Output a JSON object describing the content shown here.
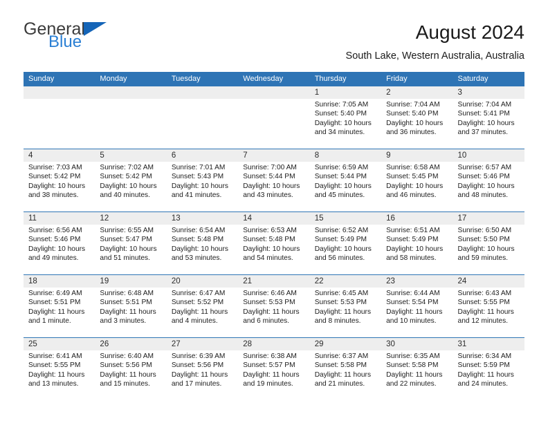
{
  "brand": {
    "name_part1": "General",
    "name_part2": "Blue",
    "triangle_color": "#1565b8",
    "blue_color": "#2a7fd4"
  },
  "header": {
    "title": "August 2024",
    "location": "South Lake, Western Australia, Australia"
  },
  "theme": {
    "header_blue": "#2e74b5",
    "daynum_band": "#eeeeee",
    "text": "#1c1c1c"
  },
  "weekdays": [
    "Sunday",
    "Monday",
    "Tuesday",
    "Wednesday",
    "Thursday",
    "Friday",
    "Saturday"
  ],
  "weeks": [
    [
      {
        "empty": true
      },
      {
        "empty": true
      },
      {
        "empty": true
      },
      {
        "empty": true
      },
      {
        "day": "1",
        "sunrise": "Sunrise: 7:05 AM",
        "sunset": "Sunset: 5:40 PM",
        "daylight1": "Daylight: 10 hours",
        "daylight2": "and 34 minutes."
      },
      {
        "day": "2",
        "sunrise": "Sunrise: 7:04 AM",
        "sunset": "Sunset: 5:40 PM",
        "daylight1": "Daylight: 10 hours",
        "daylight2": "and 36 minutes."
      },
      {
        "day": "3",
        "sunrise": "Sunrise: 7:04 AM",
        "sunset": "Sunset: 5:41 PM",
        "daylight1": "Daylight: 10 hours",
        "daylight2": "and 37 minutes."
      }
    ],
    [
      {
        "day": "4",
        "sunrise": "Sunrise: 7:03 AM",
        "sunset": "Sunset: 5:42 PM",
        "daylight1": "Daylight: 10 hours",
        "daylight2": "and 38 minutes."
      },
      {
        "day": "5",
        "sunrise": "Sunrise: 7:02 AM",
        "sunset": "Sunset: 5:42 PM",
        "daylight1": "Daylight: 10 hours",
        "daylight2": "and 40 minutes."
      },
      {
        "day": "6",
        "sunrise": "Sunrise: 7:01 AM",
        "sunset": "Sunset: 5:43 PM",
        "daylight1": "Daylight: 10 hours",
        "daylight2": "and 41 minutes."
      },
      {
        "day": "7",
        "sunrise": "Sunrise: 7:00 AM",
        "sunset": "Sunset: 5:44 PM",
        "daylight1": "Daylight: 10 hours",
        "daylight2": "and 43 minutes."
      },
      {
        "day": "8",
        "sunrise": "Sunrise: 6:59 AM",
        "sunset": "Sunset: 5:44 PM",
        "daylight1": "Daylight: 10 hours",
        "daylight2": "and 45 minutes."
      },
      {
        "day": "9",
        "sunrise": "Sunrise: 6:58 AM",
        "sunset": "Sunset: 5:45 PM",
        "daylight1": "Daylight: 10 hours",
        "daylight2": "and 46 minutes."
      },
      {
        "day": "10",
        "sunrise": "Sunrise: 6:57 AM",
        "sunset": "Sunset: 5:46 PM",
        "daylight1": "Daylight: 10 hours",
        "daylight2": "and 48 minutes."
      }
    ],
    [
      {
        "day": "11",
        "sunrise": "Sunrise: 6:56 AM",
        "sunset": "Sunset: 5:46 PM",
        "daylight1": "Daylight: 10 hours",
        "daylight2": "and 49 minutes."
      },
      {
        "day": "12",
        "sunrise": "Sunrise: 6:55 AM",
        "sunset": "Sunset: 5:47 PM",
        "daylight1": "Daylight: 10 hours",
        "daylight2": "and 51 minutes."
      },
      {
        "day": "13",
        "sunrise": "Sunrise: 6:54 AM",
        "sunset": "Sunset: 5:48 PM",
        "daylight1": "Daylight: 10 hours",
        "daylight2": "and 53 minutes."
      },
      {
        "day": "14",
        "sunrise": "Sunrise: 6:53 AM",
        "sunset": "Sunset: 5:48 PM",
        "daylight1": "Daylight: 10 hours",
        "daylight2": "and 54 minutes."
      },
      {
        "day": "15",
        "sunrise": "Sunrise: 6:52 AM",
        "sunset": "Sunset: 5:49 PM",
        "daylight1": "Daylight: 10 hours",
        "daylight2": "and 56 minutes."
      },
      {
        "day": "16",
        "sunrise": "Sunrise: 6:51 AM",
        "sunset": "Sunset: 5:49 PM",
        "daylight1": "Daylight: 10 hours",
        "daylight2": "and 58 minutes."
      },
      {
        "day": "17",
        "sunrise": "Sunrise: 6:50 AM",
        "sunset": "Sunset: 5:50 PM",
        "daylight1": "Daylight: 10 hours",
        "daylight2": "and 59 minutes."
      }
    ],
    [
      {
        "day": "18",
        "sunrise": "Sunrise: 6:49 AM",
        "sunset": "Sunset: 5:51 PM",
        "daylight1": "Daylight: 11 hours",
        "daylight2": "and 1 minute."
      },
      {
        "day": "19",
        "sunrise": "Sunrise: 6:48 AM",
        "sunset": "Sunset: 5:51 PM",
        "daylight1": "Daylight: 11 hours",
        "daylight2": "and 3 minutes."
      },
      {
        "day": "20",
        "sunrise": "Sunrise: 6:47 AM",
        "sunset": "Sunset: 5:52 PM",
        "daylight1": "Daylight: 11 hours",
        "daylight2": "and 4 minutes."
      },
      {
        "day": "21",
        "sunrise": "Sunrise: 6:46 AM",
        "sunset": "Sunset: 5:53 PM",
        "daylight1": "Daylight: 11 hours",
        "daylight2": "and 6 minutes."
      },
      {
        "day": "22",
        "sunrise": "Sunrise: 6:45 AM",
        "sunset": "Sunset: 5:53 PM",
        "daylight1": "Daylight: 11 hours",
        "daylight2": "and 8 minutes."
      },
      {
        "day": "23",
        "sunrise": "Sunrise: 6:44 AM",
        "sunset": "Sunset: 5:54 PM",
        "daylight1": "Daylight: 11 hours",
        "daylight2": "and 10 minutes."
      },
      {
        "day": "24",
        "sunrise": "Sunrise: 6:43 AM",
        "sunset": "Sunset: 5:55 PM",
        "daylight1": "Daylight: 11 hours",
        "daylight2": "and 12 minutes."
      }
    ],
    [
      {
        "day": "25",
        "sunrise": "Sunrise: 6:41 AM",
        "sunset": "Sunset: 5:55 PM",
        "daylight1": "Daylight: 11 hours",
        "daylight2": "and 13 minutes."
      },
      {
        "day": "26",
        "sunrise": "Sunrise: 6:40 AM",
        "sunset": "Sunset: 5:56 PM",
        "daylight1": "Daylight: 11 hours",
        "daylight2": "and 15 minutes."
      },
      {
        "day": "27",
        "sunrise": "Sunrise: 6:39 AM",
        "sunset": "Sunset: 5:56 PM",
        "daylight1": "Daylight: 11 hours",
        "daylight2": "and 17 minutes."
      },
      {
        "day": "28",
        "sunrise": "Sunrise: 6:38 AM",
        "sunset": "Sunset: 5:57 PM",
        "daylight1": "Daylight: 11 hours",
        "daylight2": "and 19 minutes."
      },
      {
        "day": "29",
        "sunrise": "Sunrise: 6:37 AM",
        "sunset": "Sunset: 5:58 PM",
        "daylight1": "Daylight: 11 hours",
        "daylight2": "and 21 minutes."
      },
      {
        "day": "30",
        "sunrise": "Sunrise: 6:35 AM",
        "sunset": "Sunset: 5:58 PM",
        "daylight1": "Daylight: 11 hours",
        "daylight2": "and 22 minutes."
      },
      {
        "day": "31",
        "sunrise": "Sunrise: 6:34 AM",
        "sunset": "Sunset: 5:59 PM",
        "daylight1": "Daylight: 11 hours",
        "daylight2": "and 24 minutes."
      }
    ]
  ]
}
